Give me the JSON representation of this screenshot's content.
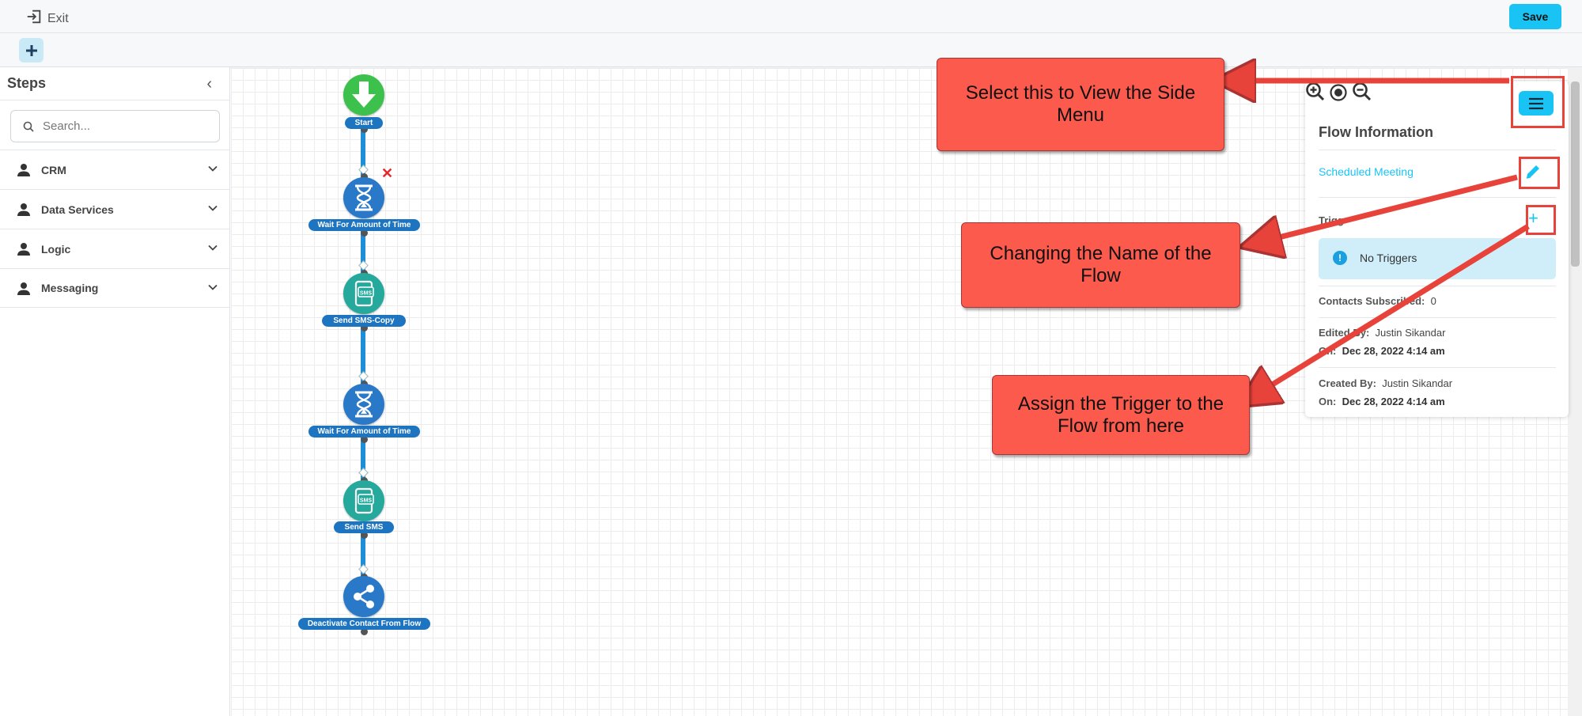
{
  "topbar": {
    "exit_label": "Exit",
    "save_label": "Save"
  },
  "sidebar": {
    "title": "Steps",
    "search_placeholder": "Search...",
    "categories": [
      {
        "label": "CRM"
      },
      {
        "label": "Data Services"
      },
      {
        "label": "Logic"
      },
      {
        "label": "Messaging"
      }
    ]
  },
  "flow": {
    "nodes": [
      {
        "label": "Start",
        "icon": "download-arrow-icon",
        "color": "#3cc14c"
      },
      {
        "label": "Wait For Amount of Time",
        "icon": "hourglass-icon",
        "color": "#2a79c8"
      },
      {
        "label": "Send SMS-Copy",
        "icon": "sms-phone-icon",
        "color": "#25a99c"
      },
      {
        "label": "Wait For Amount of Time",
        "icon": "hourglass-icon",
        "color": "#2a79c8"
      },
      {
        "label": "Send SMS",
        "icon": "sms-phone-icon",
        "color": "#25a99c"
      },
      {
        "label": "Deactivate Contact From Flow",
        "icon": "share-icon",
        "color": "#2a79c8"
      }
    ],
    "delete_mark": "✕"
  },
  "panel": {
    "title": "Flow Information",
    "flow_name": "Scheduled Meeting",
    "triggers_label": "Trigg",
    "no_triggers": "No Triggers",
    "contacts_label": "Contacts Subscribed:",
    "contacts_value": "0",
    "edited_by_label": "Edited By:",
    "edited_by_value": "Justin Sikandar",
    "edited_on_label": "On:",
    "edited_on_value": "Dec 28, 2022 4:14 am",
    "created_by_label": "Created By:",
    "created_by_value": "Justin Sikandar",
    "created_on_label": "On:",
    "created_on_value": "Dec 28, 2022 4:14 am"
  },
  "annotations": {
    "side_menu": "Select this to View the Side Menu",
    "change_name": "Changing the Name of the Flow",
    "assign_trigger": "Assign the Trigger to the Flow from here"
  },
  "colors": {
    "accent": "#19c4f5",
    "callout": "#fc5a4c",
    "connector": "#1e8ed6"
  }
}
